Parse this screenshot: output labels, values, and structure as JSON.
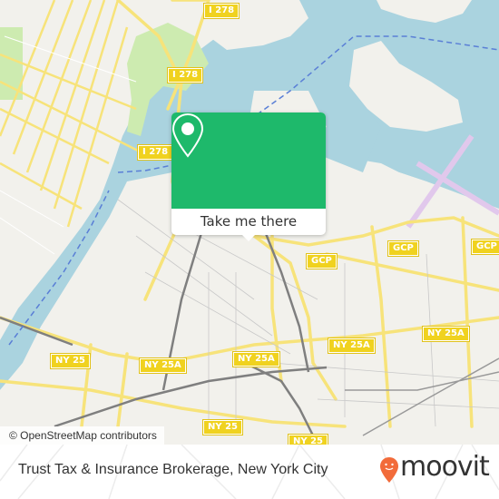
{
  "map": {
    "attribution": "© OpenStreetMap contributors",
    "colors": {
      "land": "#f2f1ec",
      "water": "#aad3df",
      "park": "#cdebb0",
      "road_major": "#f7e37a",
      "road_casing": "#e2c640",
      "rail": "#7f7f7f",
      "airport": "#e9d1f0",
      "ferry": "#5a7fd6"
    },
    "road_labels": [
      {
        "id": "i278-top",
        "text": "I 278"
      },
      {
        "id": "i278-mid",
        "text": "I 278"
      },
      {
        "id": "i278-low",
        "text": "I 278"
      },
      {
        "id": "gcp-1",
        "text": "GCP"
      },
      {
        "id": "gcp-2",
        "text": "GCP"
      },
      {
        "id": "gcp-3",
        "text": "GCP"
      },
      {
        "id": "ny25-west",
        "text": "NY 25"
      },
      {
        "id": "ny25a-1",
        "text": "NY 25A"
      },
      {
        "id": "ny25a-2",
        "text": "NY 25A"
      },
      {
        "id": "ny25a-3",
        "text": "NY 25A"
      },
      {
        "id": "ny25a-4",
        "text": "NY 25A"
      },
      {
        "id": "ny25-south",
        "text": "NY 25"
      },
      {
        "id": "ny25-south2",
        "text": "NY 25"
      }
    ]
  },
  "popup": {
    "button_label": "Take me there",
    "accent_color": "#1eb96b",
    "icon": "map-pin-icon"
  },
  "footer": {
    "title": "Trust Tax & Insurance Brokerage, New York City",
    "brand": "moovit",
    "brand_color": "#f26b3a"
  }
}
